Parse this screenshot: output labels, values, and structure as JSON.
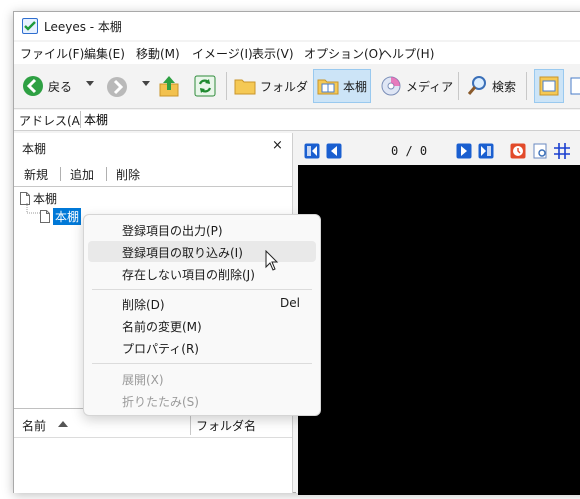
{
  "window": {
    "title": "Leeyes - 本棚",
    "app_icon": "leeyes-app-icon"
  },
  "menubar": {
    "items": [
      "ファイル(F)",
      "編集(E)",
      "移動(M)",
      "イメージ(I)",
      "表示(V)",
      "オプション(O)",
      "ヘルプ(H)"
    ]
  },
  "toolbar": {
    "back_label": "戻る",
    "folder_label": "フォルダ",
    "bookshelf_label": "本棚",
    "media_label": "メディア",
    "search_label": "検索"
  },
  "addressbar": {
    "label": "アドレス(A)",
    "value": "本棚"
  },
  "bookshelf_pane": {
    "title": "本棚",
    "close": "×",
    "tools": [
      "新規",
      "追加",
      "削除"
    ],
    "tree": {
      "root_label": "本棚",
      "child_label": "本棚"
    },
    "list_columns": [
      "名前",
      "フォルダ名"
    ]
  },
  "viewer": {
    "page_counter": "0 / 0"
  },
  "context_menu": {
    "items": [
      {
        "label": "登録項目の出力(P)",
        "shortcut": "",
        "disabled": false
      },
      {
        "label": "登録項目の取り込み(I)",
        "shortcut": "",
        "disabled": false
      },
      {
        "label": "存在しない項目の削除(J)",
        "shortcut": "",
        "disabled": false
      },
      {
        "label": "削除(D)",
        "shortcut": "Del",
        "disabled": false
      },
      {
        "label": "名前の変更(M)",
        "shortcut": "",
        "disabled": false
      },
      {
        "label": "プロパティ(R)",
        "shortcut": "",
        "disabled": false
      },
      {
        "label": "展開(X)",
        "shortcut": "",
        "disabled": true
      },
      {
        "label": "折りたたみ(S)",
        "shortcut": "",
        "disabled": true
      }
    ],
    "hovered_index": 1
  },
  "colors": {
    "selection": "#0078d7",
    "viewer_background": "#000000",
    "accent_blue": "#1a5fd0"
  }
}
